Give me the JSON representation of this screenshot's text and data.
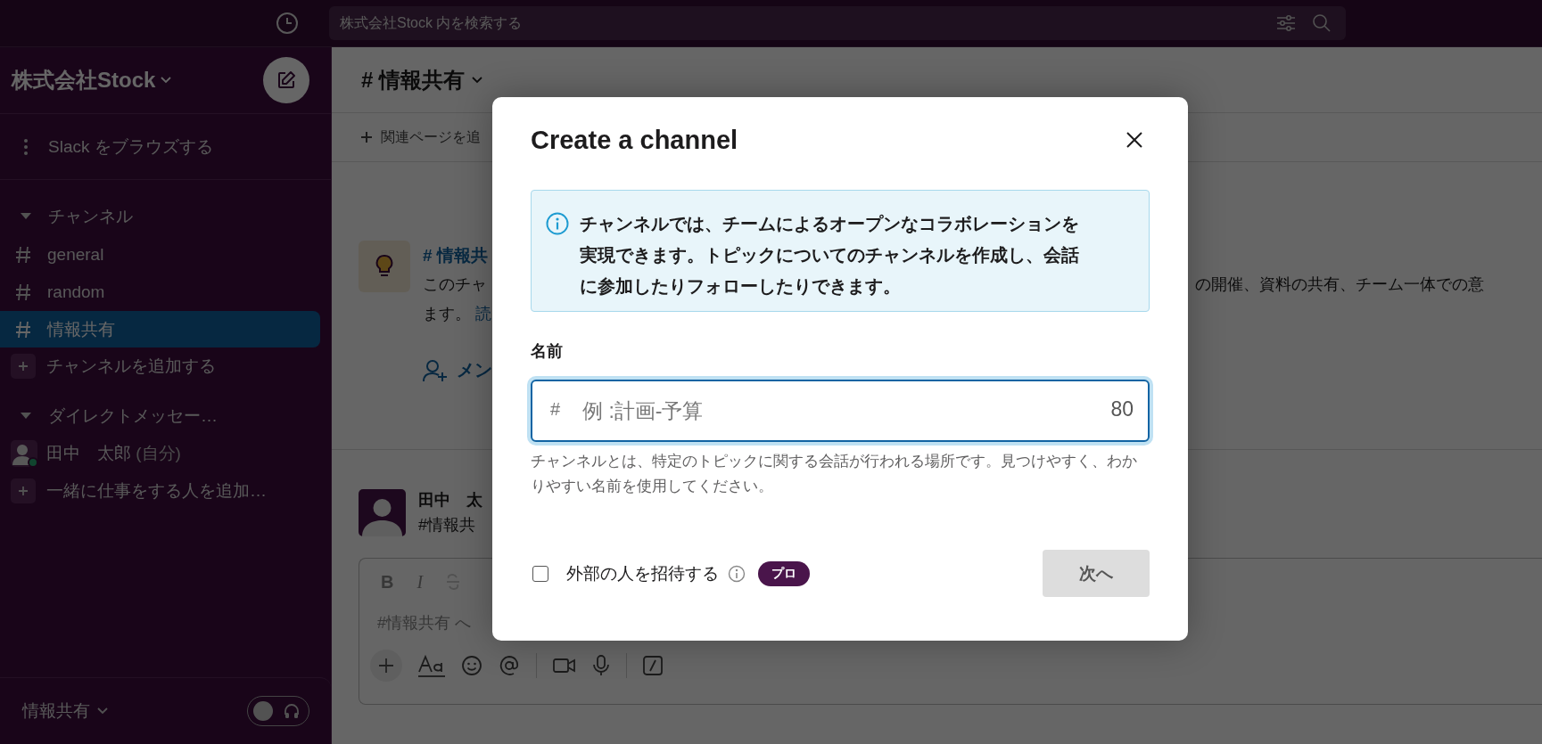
{
  "top_bar": {
    "search": {
      "placeholder": "株式会社Stock 内を検索する"
    }
  },
  "sidebar": {
    "workspace": "株式会社Stock",
    "browse": "Slack をブラウズする",
    "channels_header": "チャンネル",
    "channels": [
      {
        "name": "general",
        "selected": false
      },
      {
        "name": "random",
        "selected": false
      },
      {
        "name": "情報共有",
        "selected": true
      }
    ],
    "add_channel": "チャンネルを追加する",
    "dm_header": "ダイレクトメッセー…",
    "dms": [
      {
        "name": "田中　太郎",
        "suffix": "(自分)",
        "online": true
      }
    ],
    "add_people": "一緒に仕事をする人を追加…",
    "footer": {
      "channel": "情報共有",
      "huddle_on": false
    }
  },
  "main": {
    "channel_title": "# 情報共有",
    "bookmark": "関連ページを追",
    "intro": {
      "title": "# 情報共",
      "line_1": "このチャ",
      "line_1_right": "の開催、資料の共有、チーム一体での意",
      "line_2": "ます。",
      "link": "読"
    },
    "add_member": "メン",
    "message": {
      "author": "田中　太",
      "text": "#情報共"
    },
    "composer": {
      "format_buttons": [
        "B",
        "I"
      ],
      "placeholder": "#情報共有 へ"
    }
  },
  "modal": {
    "title": "Create a channel",
    "info": "チャンネルでは、チームによるオープンなコラボレーションを実現できます。トピックについてのチャンネルを作成し、会話に参加したりフォローしたりできます。",
    "name_label": "名前",
    "name_field": {
      "prefix": "#",
      "placeholder": "例 :計画-予算",
      "counter": "80"
    },
    "help": "チャンネルとは、特定のトピックに関する会話が行われる場所です。見つけやすく、わかりやすい名前を使用してください。",
    "external": {
      "label": "外部の人を招待する",
      "checked": false,
      "badge": "プロ"
    },
    "next_button": {
      "label": "次へ",
      "disabled": true
    }
  }
}
